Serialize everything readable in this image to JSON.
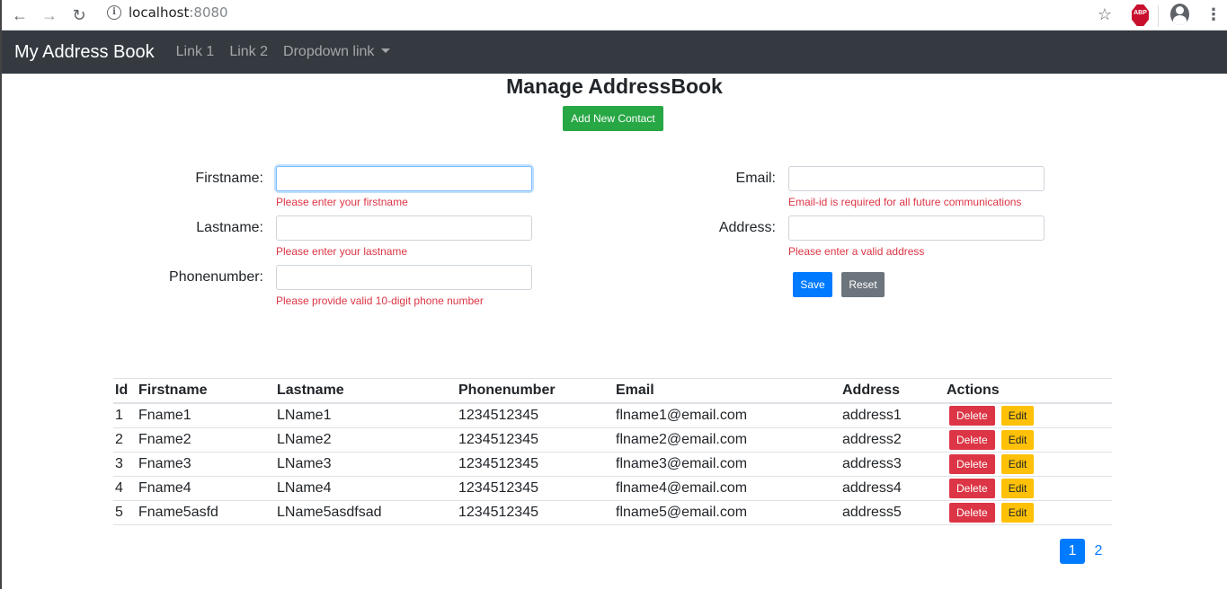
{
  "browser": {
    "url_host": "localhost",
    "url_port": ":8080",
    "abp_label": "ABP"
  },
  "navbar": {
    "brand": "My Address Book",
    "links": [
      "Link 1",
      "Link 2",
      "Dropdown link"
    ]
  },
  "page": {
    "title": "Manage AddressBook",
    "add_button": "Add New Contact"
  },
  "form": {
    "firstname": {
      "label": "Firstname:",
      "value": "",
      "error": "Please enter your firstname"
    },
    "lastname": {
      "label": "Lastname:",
      "value": "",
      "error": "Please enter your lastname"
    },
    "phonenumber": {
      "label": "Phonenumber:",
      "value": "",
      "error": "Please provide valid 10-digit phone number"
    },
    "email": {
      "label": "Email:",
      "value": "",
      "error": "Email-id is required for all future communications"
    },
    "address": {
      "label": "Address:",
      "value": "",
      "error": "Please enter a valid address"
    },
    "save_label": "Save",
    "reset_label": "Reset"
  },
  "table": {
    "headers": [
      "Id",
      "Firstname",
      "Lastname",
      "Phonenumber",
      "Email",
      "Address",
      "Actions"
    ],
    "rows": [
      {
        "id": "1",
        "firstname": "Fname1",
        "lastname": "LName1",
        "phone": "1234512345",
        "email": "flname1@email.com",
        "address": "address1"
      },
      {
        "id": "2",
        "firstname": "Fname2",
        "lastname": "LName2",
        "phone": "1234512345",
        "email": "flname2@email.com",
        "address": "address2"
      },
      {
        "id": "3",
        "firstname": "Fname3",
        "lastname": "LName3",
        "phone": "1234512345",
        "email": "flname3@email.com",
        "address": "address3"
      },
      {
        "id": "4",
        "firstname": "Fname4",
        "lastname": "LName4",
        "phone": "1234512345",
        "email": "flname4@email.com",
        "address": "address4"
      },
      {
        "id": "5",
        "firstname": "Fname5asfd",
        "lastname": "LName5asdfsad",
        "phone": "1234512345",
        "email": "flname5@email.com",
        "address": "address5"
      }
    ],
    "delete_label": "Delete",
    "edit_label": "Edit"
  },
  "pagination": {
    "pages": [
      "1",
      "2"
    ],
    "current": "1"
  }
}
